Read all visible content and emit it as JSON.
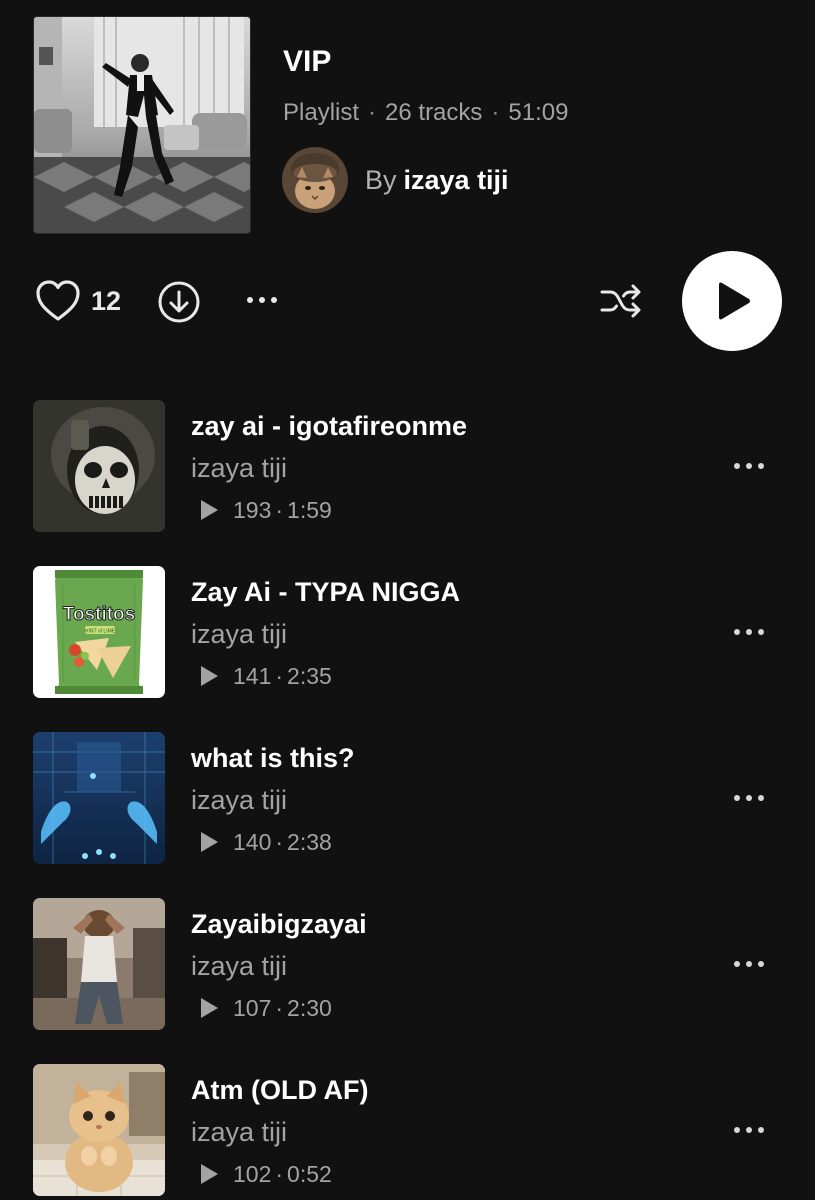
{
  "playlist": {
    "title": "VIP",
    "type": "Playlist",
    "tracks_count": "26 tracks",
    "duration": "51:09",
    "by_label": "By",
    "author": "izaya tiji"
  },
  "actions": {
    "like_count": "12"
  },
  "tracks": [
    {
      "title": "zay ai - igotafireonme",
      "artist": "izaya tiji",
      "plays": "193",
      "duration": "1:59"
    },
    {
      "title": "Zay Ai - TYPA NIGGA",
      "artist": "izaya tiji",
      "plays": "141",
      "duration": "2:35"
    },
    {
      "title": "what is this?",
      "artist": "izaya tiji",
      "plays": "140",
      "duration": "2:38"
    },
    {
      "title": "Zayaibigzayai",
      "artist": "izaya tiji",
      "plays": "107",
      "duration": "2:30"
    },
    {
      "title": "Atm (OLD AF)",
      "artist": "izaya tiji",
      "plays": "102",
      "duration": "0:52"
    }
  ],
  "thumbnail_art": {
    "cover": "Tostitos",
    "snack_sub": "HINT of LIME"
  },
  "colors": {
    "background": "#111112",
    "text_primary": "#ffffff",
    "text_secondary": "#a3a3a3",
    "play_button": "#ffffff"
  },
  "icons": [
    "heart-icon",
    "download-icon",
    "more-icon",
    "shuffle-icon",
    "play-icon"
  ]
}
